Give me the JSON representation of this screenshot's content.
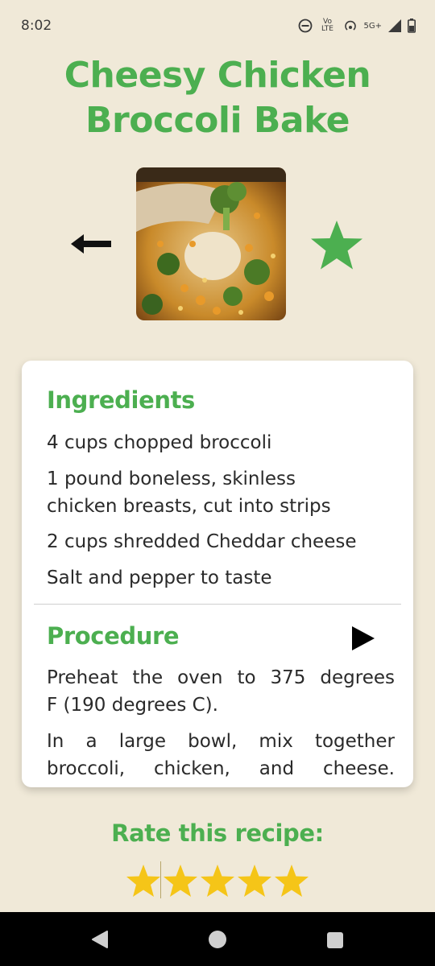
{
  "status_bar": {
    "time": "8:02",
    "network_label": "5G+",
    "volte_label": "Vo LTE"
  },
  "recipe": {
    "title_line1": "Cheesy Chicken",
    "title_line2": "Broccoli Bake",
    "is_favorite": true
  },
  "ingredients": {
    "heading": "Ingredients",
    "items": [
      "4 cups chopped broccoli",
      "1 pound boneless, skinless",
      "chicken breasts, cut into strips",
      "2 cups shredded Cheddar cheese",
      "Salt and pepper to taste"
    ]
  },
  "procedure": {
    "heading": "Procedure",
    "lines": [
      "Preheat the oven to 375 degrees",
      "F (190 degrees C).",
      "In a large bowl, mix together",
      "broccoli, chicken, and cheese."
    ]
  },
  "rating": {
    "prompt": "Rate this recipe:",
    "value": 5,
    "max": 5
  },
  "colors": {
    "accent": "#4caf50",
    "background": "#f0e9d8",
    "star": "#f5c518"
  }
}
